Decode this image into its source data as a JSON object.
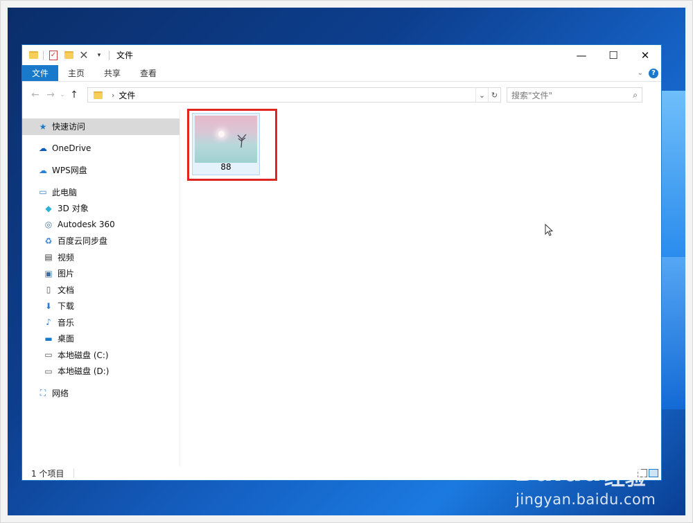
{
  "window": {
    "title": "文件",
    "tabs": [
      {
        "label": "文件",
        "active": true
      },
      {
        "label": "主页",
        "active": false
      },
      {
        "label": "共享",
        "active": false
      },
      {
        "label": "查看",
        "active": false
      }
    ],
    "controls": {
      "minimize": "—",
      "maximize": "☐",
      "close": "✕"
    }
  },
  "address": {
    "breadcrumb": [
      "文件"
    ],
    "search_placeholder": "搜索\"文件\""
  },
  "sidebar": {
    "items": [
      {
        "label": "快速访问",
        "icon": "star-icon",
        "level": 1,
        "selected": true
      },
      {
        "label": "OneDrive",
        "icon": "cloud-icon",
        "level": 1
      },
      {
        "label": "WPS网盘",
        "icon": "wps-cloud-icon",
        "level": 1
      },
      {
        "label": "此电脑",
        "icon": "pc-icon",
        "level": 1
      },
      {
        "label": "3D 对象",
        "icon": "cube-3d-icon",
        "level": 2
      },
      {
        "label": "Autodesk 360",
        "icon": "autodesk-icon",
        "level": 2
      },
      {
        "label": "百度云同步盘",
        "icon": "baidu-sync-icon",
        "level": 2
      },
      {
        "label": "视频",
        "icon": "video-icon",
        "level": 2
      },
      {
        "label": "图片",
        "icon": "picture-icon",
        "level": 2
      },
      {
        "label": "文档",
        "icon": "document-icon",
        "level": 2
      },
      {
        "label": "下载",
        "icon": "download-icon",
        "level": 2
      },
      {
        "label": "音乐",
        "icon": "music-icon",
        "level": 2
      },
      {
        "label": "桌面",
        "icon": "desktop-icon",
        "level": 2
      },
      {
        "label": "本地磁盘 (C:)",
        "icon": "drive-c-icon",
        "level": 2
      },
      {
        "label": "本地磁盘 (D:)",
        "icon": "drive-d-icon",
        "level": 2
      },
      {
        "label": "网络",
        "icon": "network-icon",
        "level": 1
      }
    ]
  },
  "files": [
    {
      "name": "88",
      "type": "image",
      "selected": true
    }
  ],
  "status": {
    "item_count": "1 个项目"
  },
  "watermark": {
    "brand": "Baidu",
    "brand_suffix": "经验",
    "url": "jingyan.baidu.com"
  },
  "colors": {
    "accent": "#1979ca",
    "highlight": "#e0241f"
  }
}
